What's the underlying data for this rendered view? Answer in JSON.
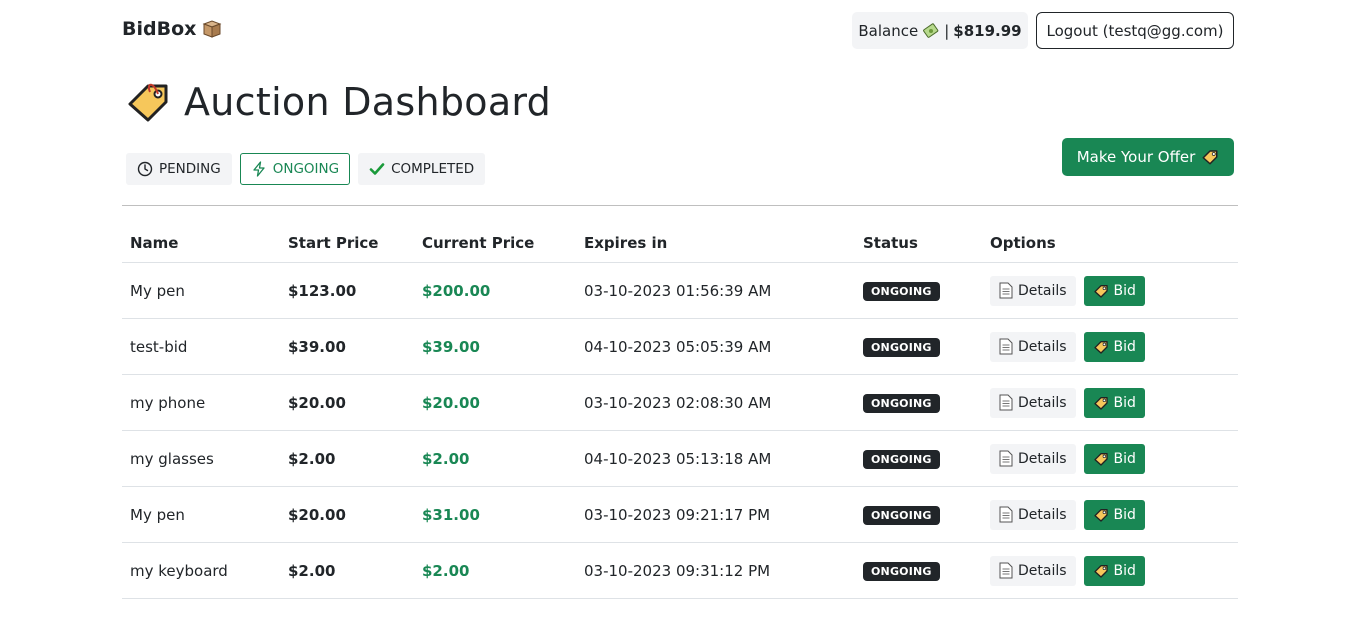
{
  "header": {
    "brand": "BidBox",
    "balance_label": "Balance",
    "balance_separator": "|",
    "balance_value": "$819.99",
    "logout_label": "Logout (testq@gg.com)"
  },
  "page": {
    "title": "Auction Dashboard",
    "offer_button": "Make Your Offer"
  },
  "filters": [
    {
      "label": "PENDING",
      "icon": "clock-icon",
      "active": false
    },
    {
      "label": "ONGOING",
      "icon": "lightning-icon",
      "active": true
    },
    {
      "label": "COMPLETED",
      "icon": "check-icon",
      "active": false
    }
  ],
  "table": {
    "headers": [
      "Name",
      "Start Price",
      "Current Price",
      "Expires in",
      "Status",
      "Options"
    ],
    "details_label": "Details",
    "bid_label": "Bid",
    "rows": [
      {
        "name": "My pen",
        "start": "$123.00",
        "current": "$200.00",
        "expires": "03-10-2023 01:56:39 AM",
        "status": "ONGOING"
      },
      {
        "name": "test-bid",
        "start": "$39.00",
        "current": "$39.00",
        "expires": "04-10-2023 05:05:39 AM",
        "status": "ONGOING"
      },
      {
        "name": "my phone",
        "start": "$20.00",
        "current": "$20.00",
        "expires": "03-10-2023 02:08:30 AM",
        "status": "ONGOING"
      },
      {
        "name": "my glasses",
        "start": "$2.00",
        "current": "$2.00",
        "expires": "04-10-2023 05:13:18 AM",
        "status": "ONGOING"
      },
      {
        "name": "My pen",
        "start": "$20.00",
        "current": "$31.00",
        "expires": "03-10-2023 09:21:17 PM",
        "status": "ONGOING"
      },
      {
        "name": "my keyboard",
        "start": "$2.00",
        "current": "$2.00",
        "expires": "03-10-2023 09:31:12 PM",
        "status": "ONGOING"
      }
    ]
  },
  "colors": {
    "accent_green": "#198754",
    "dark": "#212529",
    "pill_bg": "#f3f4f6"
  }
}
